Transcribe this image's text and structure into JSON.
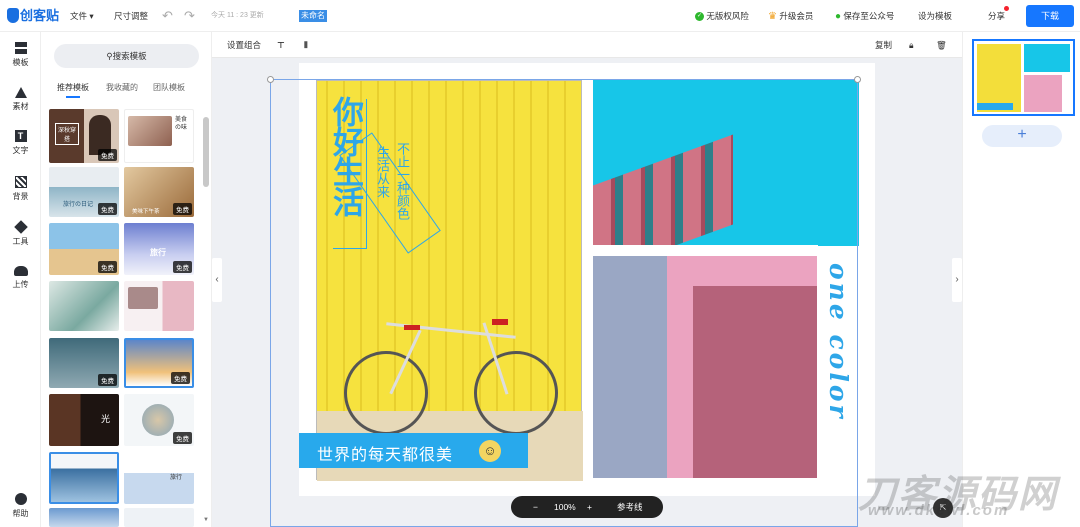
{
  "topbar": {
    "logo": "创客贴",
    "menu_file": "文件",
    "menu_resize": "尺寸调整",
    "updated": "今天 11 : 23 更新",
    "doc_name": "未命名",
    "no_risk": "无版权风险",
    "upgrade": "升级会员",
    "save_wechat": "保存至公众号",
    "set_template": "设为模板",
    "share": "分享",
    "download": "下载"
  },
  "rail": [
    {
      "label": "模板",
      "icon": "template-icon"
    },
    {
      "label": "素材",
      "icon": "material-icon"
    },
    {
      "label": "文字",
      "icon": "text-icon"
    },
    {
      "label": "背景",
      "icon": "background-icon"
    },
    {
      "label": "工具",
      "icon": "tools-icon"
    },
    {
      "label": "上传",
      "icon": "upload-icon"
    }
  ],
  "rail_help": "帮助",
  "panel": {
    "search_label": "搜索模板",
    "tabs": [
      "推荐模板",
      "我收藏的",
      "团队模板"
    ],
    "free_badge": "免费",
    "thumb_texts": {
      "t1": "深秋穿搭",
      "t2": "美食 の味",
      "t3": "旅行の日记",
      "t4": "美味下午茶",
      "t6": "旅行",
      "t10": "光",
      "t14": "旅行"
    }
  },
  "toolbar": {
    "group": "设置组合",
    "copy": "复制"
  },
  "canvas": {
    "headline": "你好生活",
    "sub1": "生活从来",
    "sub2": "不止一种颜色",
    "banner": "世界的每天都很美",
    "side": "one color"
  },
  "zoom": {
    "minus": "−",
    "value": "100%",
    "plus": "+",
    "guides": "参考线"
  },
  "pages": {
    "add": "+"
  },
  "watermark": {
    "main": "刀客源码网",
    "sub": "www.dkewl.com"
  },
  "colors": {
    "accent": "#1677ff",
    "yellow": "#f3de3a",
    "cyan": "#17c6e8",
    "pink": "#eba3c0",
    "banner": "#28a9ec"
  }
}
